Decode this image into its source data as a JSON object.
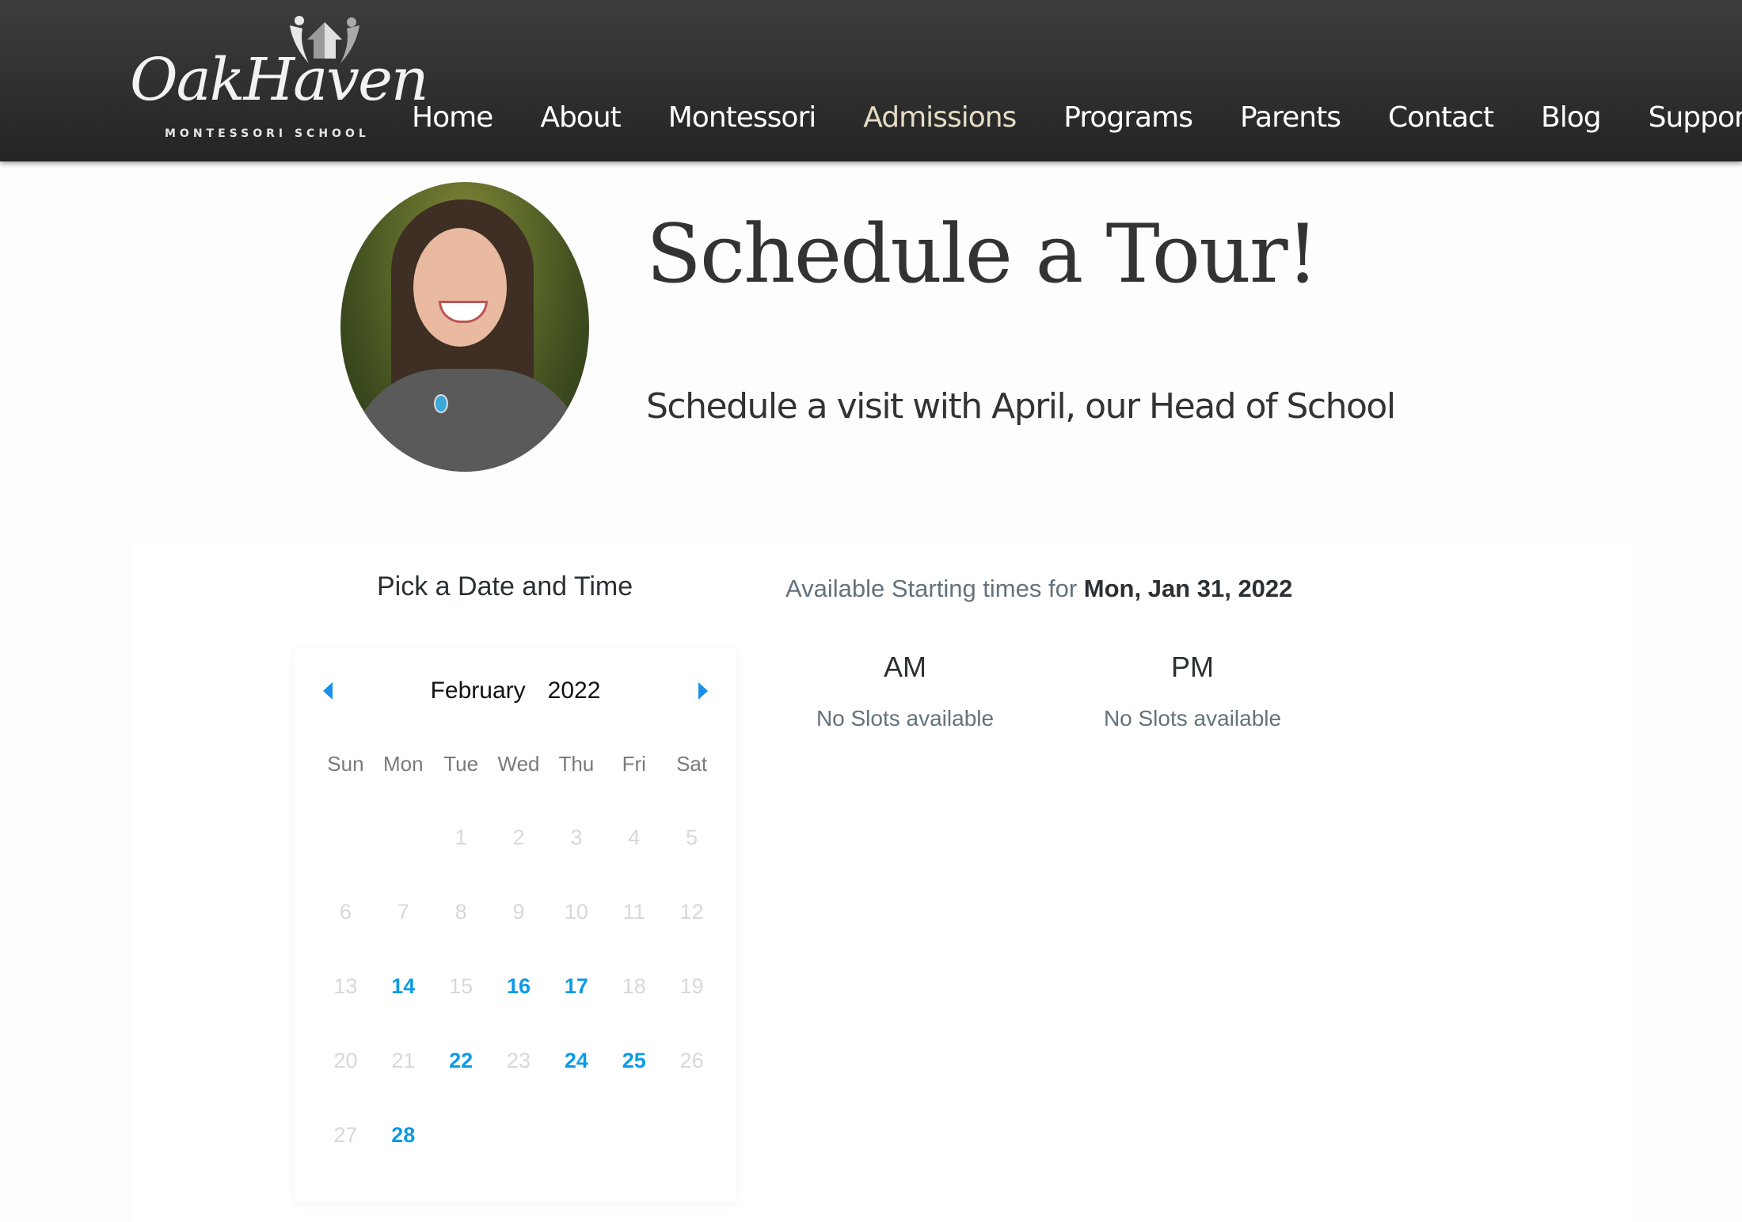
{
  "header": {
    "logo": {
      "name": "OakHaven",
      "tagline": "MONTESSORI SCHOOL"
    },
    "nav": [
      {
        "label": "Home",
        "active": false
      },
      {
        "label": "About",
        "active": false
      },
      {
        "label": "Montessori",
        "active": false
      },
      {
        "label": "Admissions",
        "active": true
      },
      {
        "label": "Programs",
        "active": false
      },
      {
        "label": "Parents",
        "active": false
      },
      {
        "label": "Contact",
        "active": false
      },
      {
        "label": "Blog",
        "active": false
      },
      {
        "label": "Support",
        "active": false
      }
    ],
    "active_color": "#e6dcc4"
  },
  "hero": {
    "photo_alt": "April, Head of School",
    "title": "Schedule a Tour!",
    "subtitle": "Schedule a visit with April, our Head of School"
  },
  "booking": {
    "heading": "Pick a Date and Time",
    "calendar": {
      "month": "February",
      "year": "2022",
      "prev_icon": "caret-left",
      "next_icon": "caret-right",
      "weekdays": [
        "Sun",
        "Mon",
        "Tue",
        "Wed",
        "Thu",
        "Fri",
        "Sat"
      ],
      "leading_blanks": 2,
      "days": [
        {
          "d": "1",
          "available": false
        },
        {
          "d": "2",
          "available": false
        },
        {
          "d": "3",
          "available": false
        },
        {
          "d": "4",
          "available": false
        },
        {
          "d": "5",
          "available": false
        },
        {
          "d": "6",
          "available": false
        },
        {
          "d": "7",
          "available": false
        },
        {
          "d": "8",
          "available": false
        },
        {
          "d": "9",
          "available": false
        },
        {
          "d": "10",
          "available": false
        },
        {
          "d": "11",
          "available": false
        },
        {
          "d": "12",
          "available": false
        },
        {
          "d": "13",
          "available": false
        },
        {
          "d": "14",
          "available": true
        },
        {
          "d": "15",
          "available": false
        },
        {
          "d": "16",
          "available": true
        },
        {
          "d": "17",
          "available": true
        },
        {
          "d": "18",
          "available": false
        },
        {
          "d": "19",
          "available": false
        },
        {
          "d": "20",
          "available": false
        },
        {
          "d": "21",
          "available": false
        },
        {
          "d": "22",
          "available": true
        },
        {
          "d": "23",
          "available": false
        },
        {
          "d": "24",
          "available": true
        },
        {
          "d": "25",
          "available": true
        },
        {
          "d": "26",
          "available": false
        },
        {
          "d": "27",
          "available": false
        },
        {
          "d": "28",
          "available": true
        }
      ],
      "accent_color": "#0d9ae6"
    },
    "availability": {
      "prefix": "Available Starting times for",
      "selected_date": "Mon, Jan 31, 2022",
      "am_label": "AM",
      "pm_label": "PM",
      "am_status": "No Slots available",
      "pm_status": "No Slots available"
    }
  }
}
